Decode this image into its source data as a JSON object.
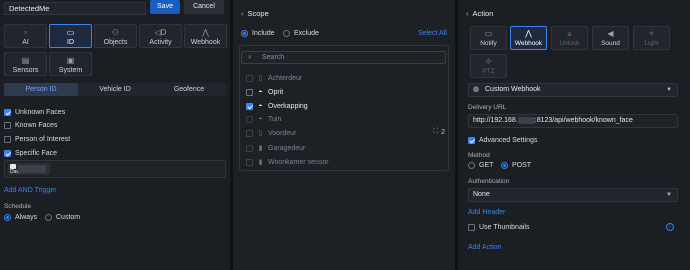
{
  "trigger": {
    "name_value": "DetectedMe",
    "save_label": "Save",
    "cancel_label": "Cancel",
    "tiles": [
      {
        "label": "AI",
        "icon": "▫"
      },
      {
        "label": "ID",
        "icon": "▭"
      },
      {
        "label": "Objects",
        "icon": "⚇"
      },
      {
        "label": "Activity",
        "icon": "◁D"
      },
      {
        "label": "Webhook",
        "icon": "⋀"
      },
      {
        "label": "Sensors",
        "icon": "▤"
      },
      {
        "label": "System",
        "icon": "▣"
      }
    ],
    "segments": [
      "Person ID",
      "Vehicle ID",
      "Geofence"
    ],
    "face_options": [
      {
        "label": "Unknown Faces",
        "checked": true
      },
      {
        "label": "Known Faces",
        "checked": false
      },
      {
        "label": "Person of Interest",
        "checked": false
      },
      {
        "label": "Specific Face",
        "checked": true
      }
    ],
    "face_chip_label": "Dave",
    "add_and_trigger": "Add AND Trigger",
    "schedule_label": "Schedule",
    "schedule_options": [
      {
        "label": "Always",
        "selected": true
      },
      {
        "label": "Custom",
        "selected": false
      }
    ]
  },
  "scope": {
    "title": "Scope",
    "include_label": "Include",
    "exclude_label": "Exclude",
    "select_all": "Select All",
    "search_placeholder": "Search",
    "items": [
      {
        "label": "Achterdeur",
        "checked": false,
        "enabled": false,
        "icon": "▯"
      },
      {
        "label": "Oprit",
        "checked": false,
        "enabled": true,
        "icon": "◓"
      },
      {
        "label": "Overkapping",
        "checked": true,
        "enabled": true,
        "icon": "◓"
      },
      {
        "label": "Tuin",
        "checked": false,
        "enabled": false,
        "icon": "◓"
      },
      {
        "label": "Voordeur",
        "checked": false,
        "enabled": false,
        "icon": "▯"
      },
      {
        "label": "Garagedeur",
        "checked": false,
        "enabled": false,
        "icon": "▮"
      },
      {
        "label": "Woonkamer sensor",
        "checked": false,
        "enabled": false,
        "icon": "▮"
      }
    ],
    "voordeur_count": "2"
  },
  "action": {
    "title": "Action",
    "tiles": [
      {
        "label": "Notify",
        "icon": "▭"
      },
      {
        "label": "Webhook",
        "icon": "⋀"
      },
      {
        "label": "Unlock",
        "icon": "🔒︎"
      },
      {
        "label": "Sound",
        "icon": "◀"
      },
      {
        "label": "Light",
        "icon": "✦"
      },
      {
        "label": "PTZ",
        "icon": "✥"
      }
    ],
    "webhook_select": "Custom Webhook",
    "delivery_url_label": "Delivery URL",
    "url_prefix": "http://192.168.",
    "url_suffix": ":8123/api/webhook/known_face",
    "advanced_settings": "Advanced Settings",
    "method_label": "Method",
    "method_options": [
      {
        "label": "GET",
        "selected": false
      },
      {
        "label": "POST",
        "selected": true
      }
    ],
    "authentication_label": "Authentication",
    "authentication_value": "None",
    "add_header": "Add Header",
    "use_thumbnails": "Use Thumbnails",
    "add_action": "Add Action"
  }
}
